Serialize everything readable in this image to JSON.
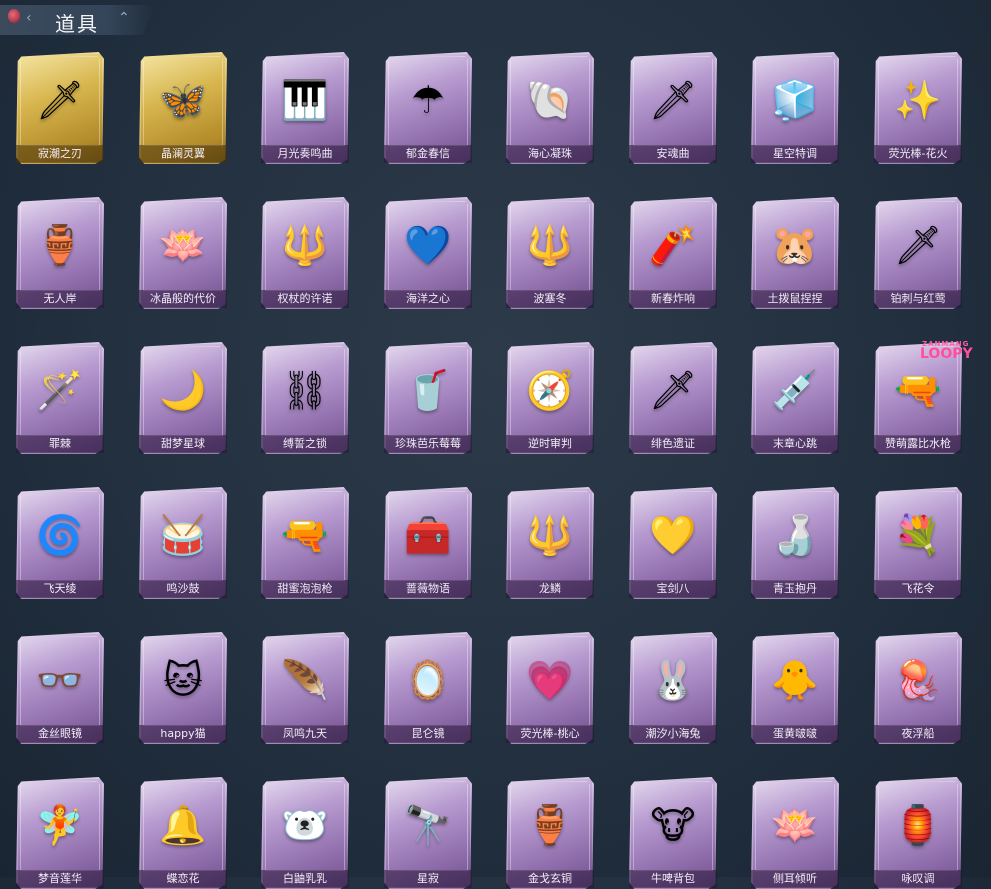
{
  "header": {
    "title": "道具"
  },
  "watermark": {
    "line1": "ZANMANG",
    "line2": "LOOPY"
  },
  "items": [
    {
      "label": "寂潮之刃",
      "glyph": "🗡",
      "frame": "gold"
    },
    {
      "label": "晶澜灵翼",
      "glyph": "🦋",
      "frame": "gold"
    },
    {
      "label": "月光奏鸣曲",
      "glyph": "🎹",
      "frame": "purple"
    },
    {
      "label": "郁金春信",
      "glyph": "☂",
      "frame": "purple"
    },
    {
      "label": "海心凝珠",
      "glyph": "🐚",
      "frame": "purple"
    },
    {
      "label": "安魂曲",
      "glyph": "🗡",
      "frame": "purple"
    },
    {
      "label": "星空特调",
      "glyph": "🧊",
      "frame": "purple"
    },
    {
      "label": "荧光棒-花火",
      "glyph": "✨",
      "frame": "purple"
    },
    {
      "label": "无人岸",
      "glyph": "🏺",
      "frame": "purple"
    },
    {
      "label": "冰晶般的代价",
      "glyph": "🪷",
      "frame": "purple"
    },
    {
      "label": "权杖的许诺",
      "glyph": "🔱",
      "frame": "purple"
    },
    {
      "label": "海洋之心",
      "glyph": "💙",
      "frame": "purple"
    },
    {
      "label": "波塞冬",
      "glyph": "🔱",
      "frame": "purple"
    },
    {
      "label": "新春炸响",
      "glyph": "🧨",
      "frame": "purple"
    },
    {
      "label": "土拨鼠捏捏",
      "glyph": "🐹",
      "frame": "purple"
    },
    {
      "label": "铂刺与红莺",
      "glyph": "🗡",
      "frame": "purple"
    },
    {
      "label": "罪棘",
      "glyph": "🪄",
      "frame": "purple"
    },
    {
      "label": "甜梦星球",
      "glyph": "🌙",
      "frame": "purple"
    },
    {
      "label": "缚誓之锁",
      "glyph": "⛓",
      "frame": "purple"
    },
    {
      "label": "珍珠芭乐莓莓",
      "glyph": "🥤",
      "frame": "purple"
    },
    {
      "label": "逆时审判",
      "glyph": "🧭",
      "frame": "purple"
    },
    {
      "label": "绯色遗证",
      "glyph": "🗡",
      "frame": "purple"
    },
    {
      "label": "末章心跳",
      "glyph": "💉",
      "frame": "purple"
    },
    {
      "label": "赞萌露比水枪",
      "glyph": "🔫",
      "frame": "purple"
    },
    {
      "label": "飞天绫",
      "glyph": "🌀",
      "frame": "purple"
    },
    {
      "label": "鸣沙鼓",
      "glyph": "🥁",
      "frame": "purple"
    },
    {
      "label": "甜蜜泡泡枪",
      "glyph": "🔫",
      "frame": "purple"
    },
    {
      "label": "蔷薇物语",
      "glyph": "🧰",
      "frame": "purple"
    },
    {
      "label": "龙鳞",
      "glyph": "🔱",
      "frame": "purple"
    },
    {
      "label": "宝剑八",
      "glyph": "💛",
      "frame": "purple"
    },
    {
      "label": "青玉抱丹",
      "glyph": "🍶",
      "frame": "purple"
    },
    {
      "label": "飞花令",
      "glyph": "💐",
      "frame": "purple"
    },
    {
      "label": "金丝眼镜",
      "glyph": "👓",
      "frame": "purple"
    },
    {
      "label": "happy猫",
      "glyph": "🐱",
      "frame": "purple"
    },
    {
      "label": "凤鸣九天",
      "glyph": "🪶",
      "frame": "purple"
    },
    {
      "label": "昆仑镜",
      "glyph": "🪞",
      "frame": "purple"
    },
    {
      "label": "荧光棒-桃心",
      "glyph": "💗",
      "frame": "purple"
    },
    {
      "label": "潮汐小海兔",
      "glyph": "🐰",
      "frame": "purple"
    },
    {
      "label": "蛋黄啵啵",
      "glyph": "🐥",
      "frame": "purple"
    },
    {
      "label": "夜浮船",
      "glyph": "🪼",
      "frame": "purple"
    },
    {
      "label": "梦音莲华",
      "glyph": "🧚",
      "frame": "purple"
    },
    {
      "label": "蝶恋花",
      "glyph": "🔔",
      "frame": "purple"
    },
    {
      "label": "白鼬乳乳",
      "glyph": "🐻‍❄️",
      "frame": "purple"
    },
    {
      "label": "星寂",
      "glyph": "🔭",
      "frame": "purple"
    },
    {
      "label": "金戈玄铜",
      "glyph": "🏺",
      "frame": "purple"
    },
    {
      "label": "牛啤背包",
      "glyph": "🐮",
      "frame": "purple"
    },
    {
      "label": "侧耳倾听",
      "glyph": "🪷",
      "frame": "purple"
    },
    {
      "label": "咏叹调",
      "glyph": "🏮",
      "frame": "purple"
    }
  ]
}
